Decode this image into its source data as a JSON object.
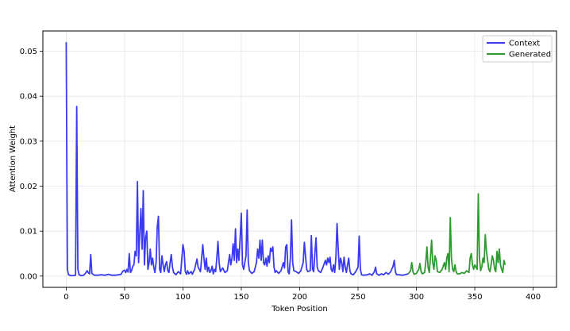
{
  "chart_data": {
    "type": "line",
    "xlabel": "Token Position",
    "ylabel": "Attention Weight",
    "xlim": [
      -20,
      420
    ],
    "ylim": [
      -0.0025,
      0.0545
    ],
    "xticks": [
      0,
      50,
      100,
      150,
      200,
      250,
      300,
      350,
      400
    ],
    "yticks": [
      0.0,
      0.01,
      0.02,
      0.03,
      0.04,
      0.05
    ],
    "ytick_labels": [
      "0.00",
      "0.01",
      "0.02",
      "0.03",
      "0.04",
      "0.05"
    ],
    "grid": true,
    "legend_position": "top-right",
    "series": [
      {
        "name": "Context",
        "color": "#3a3af0",
        "points": [
          [
            0,
            0.052
          ],
          [
            1,
            0.0015
          ],
          [
            2,
            0.0003
          ],
          [
            4,
            0.0001
          ],
          [
            6,
            0.0001
          ],
          [
            8,
            0.0002
          ],
          [
            9,
            0.0377
          ],
          [
            10,
            0.0015
          ],
          [
            11,
            0.0003
          ],
          [
            13,
            0.0001
          ],
          [
            15,
            0.0002
          ],
          [
            17,
            0.0008
          ],
          [
            18,
            0.0012
          ],
          [
            19,
            0.0007
          ],
          [
            20,
            0.0005
          ],
          [
            21,
            0.0048
          ],
          [
            22,
            0.0006
          ],
          [
            24,
            0.0002
          ],
          [
            27,
            0.0002
          ],
          [
            30,
            0.0003
          ],
          [
            33,
            0.0002
          ],
          [
            36,
            0.0004
          ],
          [
            39,
            0.0002
          ],
          [
            42,
            0.0002
          ],
          [
            45,
            0.0003
          ],
          [
            47,
            0.0004
          ],
          [
            48,
            0.0009
          ],
          [
            49,
            0.0012
          ],
          [
            50,
            0.0013
          ],
          [
            51,
            0.0008
          ],
          [
            52,
            0.0015
          ],
          [
            53,
            0.0009
          ],
          [
            54,
            0.005
          ],
          [
            55,
            0.0008
          ],
          [
            56,
            0.0012
          ],
          [
            57,
            0.0022
          ],
          [
            58,
            0.0025
          ],
          [
            59,
            0.0055
          ],
          [
            60,
            0.0045
          ],
          [
            61,
            0.021
          ],
          [
            62,
            0.003
          ],
          [
            63,
            0.0095
          ],
          [
            64,
            0.015
          ],
          [
            65,
            0.006
          ],
          [
            66,
            0.019
          ],
          [
            67,
            0.0025
          ],
          [
            68,
            0.0085
          ],
          [
            69,
            0.01
          ],
          [
            70,
            0.0015
          ],
          [
            71,
            0.003
          ],
          [
            72,
            0.006
          ],
          [
            73,
            0.0025
          ],
          [
            74,
            0.004
          ],
          [
            75,
            0.002
          ],
          [
            76,
            0.0008
          ],
          [
            77,
            0.003
          ],
          [
            78,
            0.011
          ],
          [
            79,
            0.0133
          ],
          [
            80,
            0.0015
          ],
          [
            81,
            0.0008
          ],
          [
            82,
            0.0045
          ],
          [
            83,
            0.0025
          ],
          [
            84,
            0.001
          ],
          [
            85,
            0.0025
          ],
          [
            86,
            0.0032
          ],
          [
            87,
            0.0012
          ],
          [
            88,
            0.0008
          ],
          [
            89,
            0.003
          ],
          [
            90,
            0.0048
          ],
          [
            91,
            0.002
          ],
          [
            92,
            0.0008
          ],
          [
            94,
            0.0003
          ],
          [
            96,
            0.001
          ],
          [
            98,
            0.0005
          ],
          [
            100,
            0.007
          ],
          [
            101,
            0.0055
          ],
          [
            102,
            0.001
          ],
          [
            103,
            0.0004
          ],
          [
            104,
            0.0012
          ],
          [
            105,
            0.0005
          ],
          [
            107,
            0.001
          ],
          [
            108,
            0.0004
          ],
          [
            110,
            0.0015
          ],
          [
            112,
            0.0038
          ],
          [
            113,
            0.002
          ],
          [
            115,
            0.001
          ],
          [
            117,
            0.007
          ],
          [
            118,
            0.004
          ],
          [
            119,
            0.0015
          ],
          [
            120,
            0.004
          ],
          [
            121,
            0.001
          ],
          [
            122,
            0.002
          ],
          [
            123,
            0.0008
          ],
          [
            124,
            0.0012
          ],
          [
            125,
            0.0022
          ],
          [
            126,
            0.0005
          ],
          [
            127,
            0.0015
          ],
          [
            128,
            0.001
          ],
          [
            129,
            0.004
          ],
          [
            130,
            0.0077
          ],
          [
            131,
            0.003
          ],
          [
            132,
            0.001
          ],
          [
            134,
            0.0018
          ],
          [
            136,
            0.0008
          ],
          [
            138,
            0.0012
          ],
          [
            140,
            0.0048
          ],
          [
            141,
            0.0025
          ],
          [
            142,
            0.004
          ],
          [
            143,
            0.0072
          ],
          [
            144,
            0.0035
          ],
          [
            145,
            0.0105
          ],
          [
            146,
            0.003
          ],
          [
            147,
            0.006
          ],
          [
            148,
            0.0035
          ],
          [
            149,
            0.0085
          ],
          [
            150,
            0.014
          ],
          [
            151,
            0.0025
          ],
          [
            152,
            0.0015
          ],
          [
            154,
            0.0045
          ],
          [
            155,
            0.0147
          ],
          [
            156,
            0.003
          ],
          [
            157,
            0.0012
          ],
          [
            159,
            0.0006
          ],
          [
            161,
            0.001
          ],
          [
            163,
            0.003
          ],
          [
            164,
            0.006
          ],
          [
            165,
            0.004
          ],
          [
            166,
            0.008
          ],
          [
            167,
            0.0035
          ],
          [
            168,
            0.008
          ],
          [
            169,
            0.003
          ],
          [
            170,
            0.0025
          ],
          [
            171,
            0.004
          ],
          [
            172,
            0.0022
          ],
          [
            173,
            0.0045
          ],
          [
            174,
            0.003
          ],
          [
            175,
            0.0062
          ],
          [
            176,
            0.0055
          ],
          [
            177,
            0.0065
          ],
          [
            178,
            0.002
          ],
          [
            179,
            0.0008
          ],
          [
            180,
            0.0012
          ],
          [
            182,
            0.0006
          ],
          [
            184,
            0.0012
          ],
          [
            186,
            0.003
          ],
          [
            187,
            0.0018
          ],
          [
            188,
            0.0065
          ],
          [
            189,
            0.007
          ],
          [
            190,
            0.001
          ],
          [
            191,
            0.0005
          ],
          [
            192,
            0.004
          ],
          [
            193,
            0.0125
          ],
          [
            194,
            0.003
          ],
          [
            195,
            0.0012
          ],
          [
            197,
            0.001
          ],
          [
            199,
            0.0006
          ],
          [
            201,
            0.0012
          ],
          [
            203,
            0.003
          ],
          [
            204,
            0.0075
          ],
          [
            205,
            0.0045
          ],
          [
            206,
            0.0015
          ],
          [
            207,
            0.001
          ],
          [
            209,
            0.0012
          ],
          [
            210,
            0.009
          ],
          [
            211,
            0.0015
          ],
          [
            212,
            0.001
          ],
          [
            213,
            0.005
          ],
          [
            214,
            0.0085
          ],
          [
            215,
            0.002
          ],
          [
            216,
            0.0012
          ],
          [
            218,
            0.0008
          ],
          [
            220,
            0.002
          ],
          [
            222,
            0.0035
          ],
          [
            223,
            0.0025
          ],
          [
            224,
            0.004
          ],
          [
            225,
            0.003
          ],
          [
            226,
            0.0042
          ],
          [
            227,
            0.0015
          ],
          [
            228,
            0.001
          ],
          [
            229,
            0.0025
          ],
          [
            230,
            0.0008
          ],
          [
            231,
            0.004
          ],
          [
            232,
            0.0117
          ],
          [
            233,
            0.006
          ],
          [
            234,
            0.0015
          ],
          [
            235,
            0.004
          ],
          [
            236,
            0.003
          ],
          [
            237,
            0.001
          ],
          [
            238,
            0.0042
          ],
          [
            239,
            0.002
          ],
          [
            240,
            0.0008
          ],
          [
            241,
            0.0025
          ],
          [
            242,
            0.004
          ],
          [
            243,
            0.0012
          ],
          [
            244,
            0.0005
          ],
          [
            246,
            0.0003
          ],
          [
            248,
            0.001
          ],
          [
            250,
            0.002
          ],
          [
            251,
            0.0089
          ],
          [
            252,
            0.0015
          ],
          [
            253,
            0.0003
          ],
          [
            255,
            0.0002
          ],
          [
            258,
            0.0003
          ],
          [
            260,
            0.0005
          ],
          [
            262,
            0.0002
          ],
          [
            264,
            0.001
          ],
          [
            265,
            0.002
          ],
          [
            266,
            0.0005
          ],
          [
            268,
            0.0002
          ],
          [
            270,
            0.0005
          ],
          [
            272,
            0.0003
          ],
          [
            274,
            0.0008
          ],
          [
            276,
            0.0004
          ],
          [
            278,
            0.001
          ],
          [
            280,
            0.0022
          ],
          [
            281,
            0.0035
          ],
          [
            282,
            0.001
          ],
          [
            283,
            0.0003
          ],
          [
            285,
            0.0003
          ],
          [
            288,
            0.0002
          ],
          [
            290,
            0.0003
          ],
          [
            293,
            0.0005
          ]
        ]
      },
      {
        "name": "Generated",
        "color": "#2f9a2f",
        "points": [
          [
            293,
            0.0005
          ],
          [
            295,
            0.0012
          ],
          [
            296,
            0.003
          ],
          [
            297,
            0.001
          ],
          [
            298,
            0.0004
          ],
          [
            300,
            0.0006
          ],
          [
            302,
            0.0015
          ],
          [
            303,
            0.0028
          ],
          [
            304,
            0.001
          ],
          [
            305,
            0.0005
          ],
          [
            307,
            0.0008
          ],
          [
            308,
            0.003
          ],
          [
            309,
            0.0065
          ],
          [
            310,
            0.002
          ],
          [
            311,
            0.0008
          ],
          [
            312,
            0.004
          ],
          [
            313,
            0.008
          ],
          [
            314,
            0.003
          ],
          [
            315,
            0.0015
          ],
          [
            316,
            0.0045
          ],
          [
            317,
            0.0035
          ],
          [
            318,
            0.001
          ],
          [
            320,
            0.0008
          ],
          [
            322,
            0.0015
          ],
          [
            324,
            0.003
          ],
          [
            325,
            0.0015
          ],
          [
            326,
            0.004
          ],
          [
            327,
            0.005
          ],
          [
            328,
            0.001
          ],
          [
            329,
            0.013
          ],
          [
            330,
            0.004
          ],
          [
            331,
            0.0015
          ],
          [
            332,
            0.001
          ],
          [
            333,
            0.0025
          ],
          [
            334,
            0.001
          ],
          [
            335,
            0.0005
          ],
          [
            337,
            0.0005
          ],
          [
            339,
            0.0008
          ],
          [
            341,
            0.0006
          ],
          [
            343,
            0.0012
          ],
          [
            345,
            0.0008
          ],
          [
            346,
            0.004
          ],
          [
            347,
            0.005
          ],
          [
            348,
            0.0025
          ],
          [
            349,
            0.0015
          ],
          [
            350,
            0.0025
          ],
          [
            351,
            0.002
          ],
          [
            352,
            0.0015
          ],
          [
            353,
            0.0183
          ],
          [
            354,
            0.004
          ],
          [
            355,
            0.0012
          ],
          [
            356,
            0.002
          ],
          [
            357,
            0.004
          ],
          [
            358,
            0.003
          ],
          [
            359,
            0.0092
          ],
          [
            360,
            0.0055
          ],
          [
            361,
            0.0035
          ],
          [
            362,
            0.0015
          ],
          [
            363,
            0.001
          ],
          [
            364,
            0.0025
          ],
          [
            365,
            0.0045
          ],
          [
            366,
            0.0035
          ],
          [
            367,
            0.0015
          ],
          [
            368,
            0.001
          ],
          [
            369,
            0.0055
          ],
          [
            370,
            0.003
          ],
          [
            371,
            0.006
          ],
          [
            372,
            0.0025
          ],
          [
            373,
            0.0015
          ],
          [
            374,
            0.0008
          ],
          [
            375,
            0.0035
          ],
          [
            376,
            0.0025
          ]
        ]
      }
    ]
  }
}
